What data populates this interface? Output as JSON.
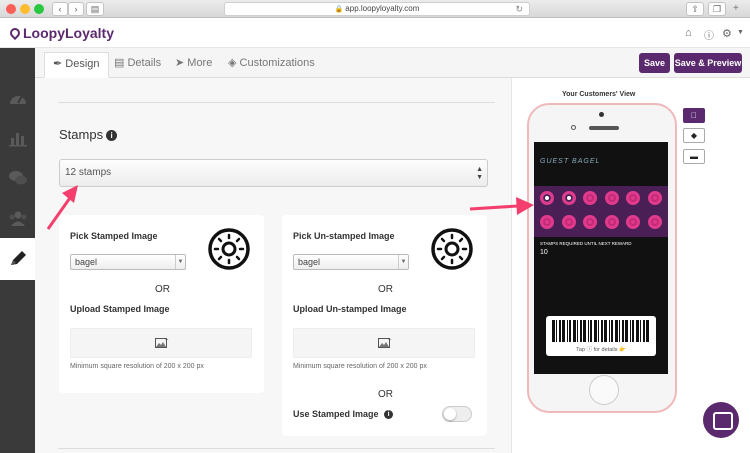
{
  "browser": {
    "url": "app.loopyloyalty.com"
  },
  "app": {
    "brand": "LoopyLoyalty"
  },
  "tabs": [
    {
      "label": "Design",
      "icon": "brush-icon"
    },
    {
      "label": "Details",
      "icon": "document-icon"
    },
    {
      "label": "More",
      "icon": "location-arrow-icon"
    },
    {
      "label": "Customizations",
      "icon": "tags-icon"
    }
  ],
  "actions": {
    "save": "Save",
    "save_preview": "Save & Preview"
  },
  "stamps": {
    "title": "Stamps",
    "selected": "12 stamps"
  },
  "stamped": {
    "title": "Pick Stamped Image",
    "select_value": "bagel",
    "or": "OR",
    "upload_title": "Upload Stamped Image",
    "hint": "Minimum square resolution of 200 x 200 px"
  },
  "unstamped": {
    "title": "Pick Un-stamped Image",
    "select_value": "bagel",
    "or": "OR",
    "upload_title": "Upload Un-stamped Image",
    "hint": "Minimum square resolution of 200 x 200 px",
    "or2": "OR",
    "use_stamped_label": "Use Stamped Image",
    "use_stamped_enabled": false
  },
  "preview": {
    "title": "Your Customers' View",
    "card_logo_text": "GUEST BAGEL",
    "stamps_required_label": "STAMPS REQUIRED UNTIL NEXT REWARD",
    "stamps_required_value": "10",
    "tap_details": "Tap ⓘ for details 👉",
    "stamped_count": 2,
    "total_stamps": 12,
    "os_options": [
      "",
      "◆",
      "▬"
    ]
  },
  "colors": {
    "brand": "#5b2a6e",
    "arrow": "#f43f6e",
    "stamp_ring": "#e03a8c"
  }
}
